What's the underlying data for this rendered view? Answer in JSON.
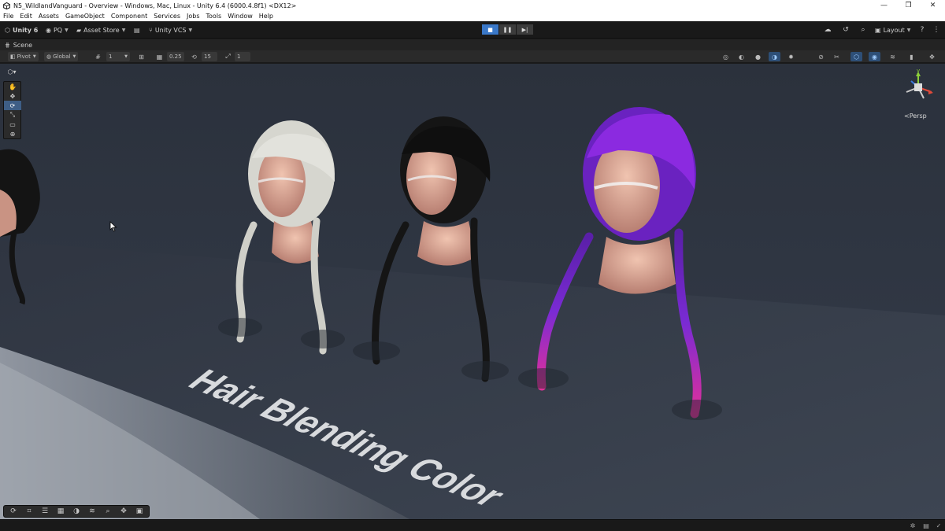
{
  "window": {
    "title": "N5_WildlandVanguard - Overview - Windows, Mac, Linux - Unity 6.4 (6000.4.8f1) <DX12>",
    "controls": {
      "minimize": "—",
      "restore": "❐",
      "close": "✕"
    }
  },
  "menu": [
    "File",
    "Edit",
    "Assets",
    "GameObject",
    "Component",
    "Services",
    "Jobs",
    "Tools",
    "Window",
    "Help"
  ],
  "toolbar": {
    "unity_label": "Unity 6",
    "account_label": "PQ",
    "asset_store_label": "Asset Store",
    "vcs_label": "Unity VCS",
    "layout_label": "Layout"
  },
  "scene_tab": {
    "label": "Scene"
  },
  "scene_toolbar": {
    "pivot_label": "Pivot",
    "global_label": "Global",
    "grid_size": "1",
    "snap_increment": "0.25",
    "rotate_snap": "15",
    "scale_snap": "1"
  },
  "viewport": {
    "floor_text": "Hair Blending Color",
    "persp_label": "Persp",
    "gizmo_y": "y",
    "gizmo_x": "x",
    "colors": {
      "hair_white": "#d6d6cf",
      "hair_black": "#151515",
      "hair_purple": "#7a2bd4",
      "hair_tip": "#e0309a",
      "wall": "#2e3644",
      "floor": "#3a414e"
    }
  },
  "icons": {
    "play": "play-icon",
    "pause": "pause-icon",
    "step": "step-icon"
  }
}
